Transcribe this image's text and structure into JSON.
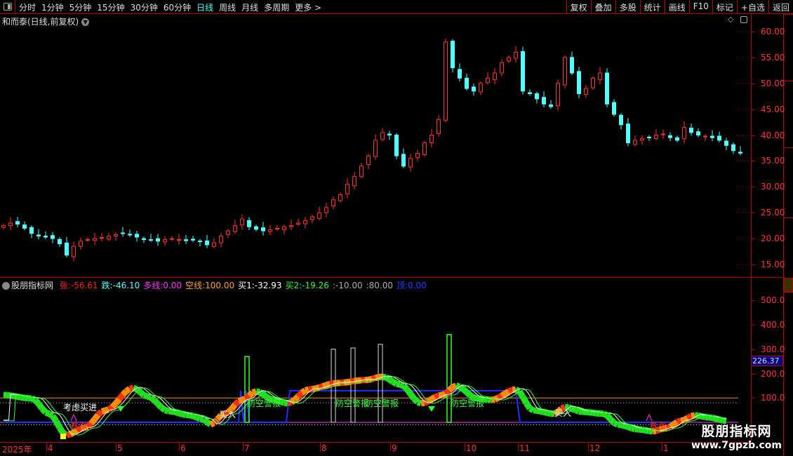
{
  "toolbar": {
    "periods": [
      "分时",
      "1分钟",
      "5分钟",
      "15分钟",
      "30分钟",
      "60分钟",
      "日线",
      "周线",
      "月线",
      "多周期",
      "更多 >"
    ],
    "active": "日线",
    "buttons": [
      "复权",
      "叠加",
      "多股",
      "统计",
      "画线",
      "F10",
      "标记",
      "+自选",
      "返回"
    ]
  },
  "chart": {
    "title": "和而泰(日线,前复权)",
    "price_axis": [
      "60.00",
      "55.00",
      "50.00",
      "45.00",
      "40.00",
      "35.00",
      "30.00",
      "25.00",
      "20.00",
      "15.00"
    ],
    "closes": [
      22.5,
      23,
      22.8,
      22,
      21,
      20.5,
      20.3,
      20,
      19,
      16.8,
      18.5,
      19.5,
      19.8,
      20,
      20.2,
      20.5,
      20.8,
      21,
      20.7,
      20.3,
      19.8,
      19.7,
      19.5,
      19.8,
      20,
      19.8,
      19.6,
      19.7,
      19.4,
      18.8,
      19.2,
      20.5,
      21.5,
      22.5,
      23.8,
      22.3,
      21.8,
      21.5,
      21.7,
      22,
      22.3,
      22.5,
      23,
      23.5,
      24.2,
      25,
      26,
      27.5,
      28.5,
      30.5,
      32,
      34,
      36,
      39,
      40.5,
      40,
      36,
      34,
      35.5,
      36.5,
      38.5,
      40,
      43,
      58,
      53,
      51,
      49,
      48.5,
      50,
      51,
      52,
      54,
      55,
      56,
      48.5,
      48,
      47,
      46,
      45.5,
      50,
      55,
      52,
      48,
      49,
      51,
      52,
      46,
      44,
      42,
      38.5,
      39,
      39.3,
      39.5,
      40,
      40.2,
      39.5,
      39,
      41.5,
      40.5,
      40,
      39.8,
      39.5,
      39,
      38,
      37,
      36.5
    ],
    "up_color": "#ff3232",
    "down_color": "#54ffff"
  },
  "indicator": {
    "name": "股朋指标网",
    "legend": [
      {
        "label": "张:-56.61",
        "color": "#ff2020"
      },
      {
        "label": "跌:-46.10",
        "color": "#54ffff"
      },
      {
        "label": "多线:0.00",
        "color": "#ff30ff"
      },
      {
        "label": "空线:100.00",
        "color": "#ffa020"
      },
      {
        "label": "买1:-32.93",
        "color": "#ffffff"
      },
      {
        "label": "买2:-19.26",
        "color": "#30ff30"
      },
      {
        "label": ":-10.00",
        "color": "#aaaaaa"
      },
      {
        "label": ":80.00",
        "color": "#aaaaaa"
      },
      {
        "label": "顶:0.00",
        "color": "#2040ff"
      }
    ],
    "axis": [
      "500.0",
      "400.0",
      "300.0",
      "200.0",
      "100.0"
    ],
    "current": "226.37",
    "oscillator": [
      [
        0,
        112
      ],
      [
        4,
        98
      ],
      [
        6.5,
        35
      ],
      [
        9,
        -52
      ],
      [
        11.5,
        -23
      ],
      [
        14.5,
        49
      ],
      [
        18.5,
        141
      ],
      [
        20.5,
        106
      ],
      [
        23.5,
        46
      ],
      [
        26.5,
        29
      ],
      [
        28.5,
        12
      ],
      [
        29.5,
        -9
      ],
      [
        31.5,
        35
      ],
      [
        34,
        92
      ],
      [
        36,
        127
      ],
      [
        38.5,
        92
      ],
      [
        40.5,
        78
      ],
      [
        43.5,
        135
      ],
      [
        47.5,
        161
      ],
      [
        51.5,
        173
      ],
      [
        54,
        187
      ],
      [
        56.5,
        155
      ],
      [
        59.5,
        78
      ],
      [
        62.5,
        112
      ],
      [
        64.5,
        150
      ],
      [
        67.5,
        98
      ],
      [
        69.5,
        92
      ],
      [
        73,
        135
      ],
      [
        75.5,
        49
      ],
      [
        78.5,
        35
      ],
      [
        80,
        63
      ],
      [
        82.5,
        43
      ],
      [
        85.5,
        35
      ],
      [
        87.5,
        -9
      ],
      [
        90.5,
        -29
      ],
      [
        92.5,
        -37
      ],
      [
        94.5,
        -23
      ],
      [
        96.5,
        6
      ],
      [
        98.5,
        29
      ],
      [
        100.5,
        20
      ],
      [
        103,
        6
      ]
    ],
    "green_bars": [
      [
        34.7,
        270
      ],
      [
        63.5,
        360
      ]
    ],
    "white_bars": [
      [
        47,
        300
      ],
      [
        49.8,
        305
      ],
      [
        53.7,
        320
      ]
    ],
    "top_line": [
      [
        0,
        0
      ],
      [
        33.5,
        0
      ],
      [
        33.8,
        130
      ],
      [
        34.2,
        0
      ],
      [
        34.6,
        130
      ],
      [
        35,
        0
      ],
      [
        40.3,
        0
      ],
      [
        40.8,
        130
      ],
      [
        73,
        130
      ],
      [
        73.6,
        0
      ],
      [
        97.5,
        0
      ]
    ],
    "annotations": {
      "consider_buy": "考虑买进",
      "bullish": "看涨",
      "buy": "买入",
      "air_raid": "防空警报"
    }
  },
  "xaxis": [
    "2025年",
    "4",
    "5",
    "6",
    "7",
    "8",
    "9",
    "10",
    "11",
    "12",
    "1"
  ],
  "watermark": {
    "name": "股朋指标网",
    "url": "www.7gpzb.com"
  }
}
